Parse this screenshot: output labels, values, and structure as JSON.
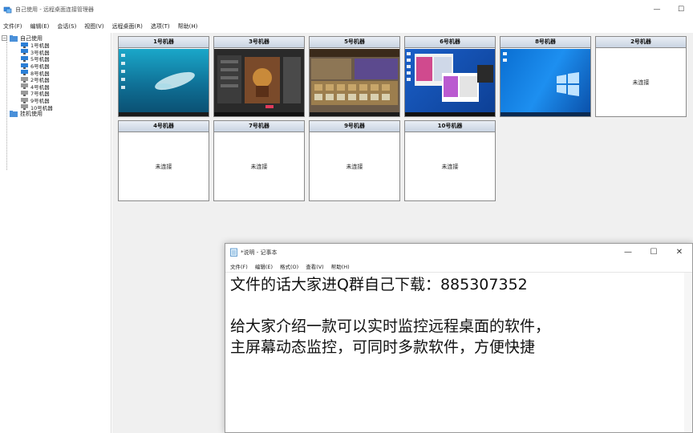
{
  "window": {
    "title": "自己使用 - 远程桌面连接管理器",
    "minimize": "—",
    "maximize": "☐",
    "close": "✕"
  },
  "menu": [
    "文件(F)",
    "编辑(E)",
    "会话(S)",
    "视图(V)",
    "远程桌面(R)",
    "选项(T)",
    "帮助(H)"
  ],
  "tree": {
    "root": "自己使用",
    "children": [
      "1号机器",
      "3号机器",
      "5号机器",
      "6号机器",
      "8号机器",
      "2号机器",
      "4号机器",
      "7号机器",
      "9号机器",
      "10号机器"
    ],
    "group2": "挂机使用"
  },
  "tiles": [
    {
      "name": "1号机器",
      "status": ""
    },
    {
      "name": "3号机器",
      "status": ""
    },
    {
      "name": "5号机器",
      "status": ""
    },
    {
      "name": "6号机器",
      "status": ""
    },
    {
      "name": "8号机器",
      "status": ""
    },
    {
      "name": "2号机器",
      "status": "未连接"
    },
    {
      "name": "4号机器",
      "status": "未连接"
    },
    {
      "name": "7号机器",
      "status": "未连接"
    },
    {
      "name": "9号机器",
      "status": "未连接"
    },
    {
      "name": "10号机器",
      "status": "未连接"
    }
  ],
  "notepad": {
    "title": "*说明 - 记事本",
    "menu": [
      "文件(F)",
      "编辑(E)",
      "格式(O)",
      "查看(V)",
      "帮助(H)"
    ],
    "lines": [
      "文件的话大家进Q群自己下载：885307352",
      "",
      "给大家介绍一款可以实时监控远程桌面的软件，",
      "主屏幕动态监控，可同时多款软件，方便快捷"
    ]
  }
}
